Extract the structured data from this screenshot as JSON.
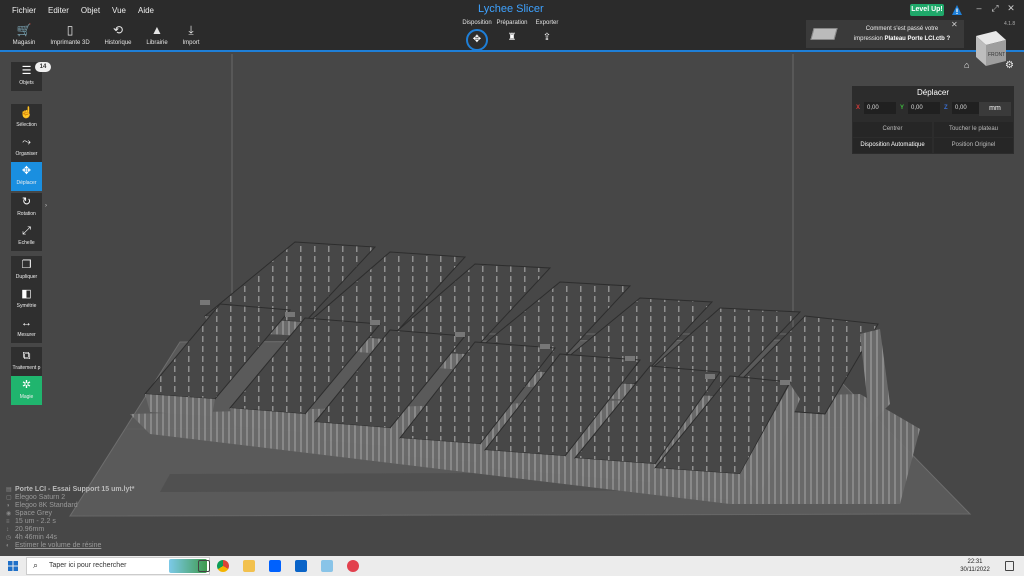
{
  "menu": [
    "Fichier",
    "Editer",
    "Objet",
    "Vue",
    "Aide"
  ],
  "app_title": "Lychee Slicer",
  "level_up": "Level Up!",
  "toolbar": [
    {
      "icon": "cart-icon",
      "glyph": "🛒",
      "label": "Magasin"
    },
    {
      "icon": "phone-icon",
      "glyph": "▯",
      "label": "Imprimante 3D"
    },
    {
      "icon": "history-icon",
      "glyph": "⟲",
      "label": "Historique"
    },
    {
      "icon": "library-icon",
      "glyph": "▲",
      "label": "Librairie"
    },
    {
      "icon": "import-icon",
      "glyph": "⤓",
      "label": "Import"
    }
  ],
  "tabs": [
    {
      "label": "Disposition",
      "glyph": "✥",
      "active": true
    },
    {
      "label": "Préparation",
      "glyph": "♜",
      "active": false
    },
    {
      "label": "Exporter",
      "glyph": "⇪",
      "active": false
    }
  ],
  "notification": {
    "line1": "Comment s'est passé votre",
    "line2_prefix": "impression",
    "line2_file": "Plateau Porte LCI.ctb ?"
  },
  "version": "4.1.8",
  "cube_label": "FRONT",
  "objects_badge": "14",
  "tools": [
    {
      "name": "objects",
      "glyph": "☰",
      "label": "Objets",
      "state": "normal",
      "arrow": false
    },
    {
      "name": "selection",
      "glyph": "☝",
      "label": "Sélection",
      "state": "normal",
      "arrow": false
    },
    {
      "name": "organize",
      "glyph": "⤳",
      "label": "Organiser",
      "state": "normal",
      "arrow": false
    },
    {
      "name": "move",
      "glyph": "✥",
      "label": "Déplacer",
      "state": "active",
      "arrow": false
    },
    {
      "name": "rotation",
      "glyph": "↻",
      "label": "Rotation",
      "state": "normal",
      "arrow": true
    },
    {
      "name": "scale",
      "glyph": "⤢",
      "label": "Echelle",
      "state": "normal",
      "arrow": false
    },
    {
      "name": "duplicate",
      "glyph": "❐",
      "label": "Dupliquer",
      "state": "normal",
      "arrow": false
    },
    {
      "name": "symmetry",
      "glyph": "◧",
      "label": "Symétrie",
      "state": "normal",
      "arrow": false
    },
    {
      "name": "measure",
      "glyph": "↔",
      "label": "Mesurer",
      "state": "normal",
      "arrow": false
    },
    {
      "name": "processing",
      "glyph": "⧉",
      "label": "Traitement p",
      "state": "normal",
      "arrow": false
    },
    {
      "name": "magic",
      "glyph": "✲",
      "label": "Magie",
      "state": "green",
      "arrow": false
    }
  ],
  "move_panel": {
    "title": "Déplacer",
    "x_label": "X",
    "x": "0,00",
    "y_label": "Y",
    "y": "0,00",
    "z_label": "Z",
    "z": "0,00",
    "unit": "mm",
    "center": "Centrer",
    "touch_plate": "Toucher le plateau",
    "auto_layout": "Disposition Automatique",
    "original_position": "Position Originel"
  },
  "info": {
    "file": "Porte LCI - Essai Support 15 um.lyt*",
    "printer": "Elegoo Saturn 2",
    "screen": "Elegoo 8K Standard",
    "resin": "Space Grey",
    "layer": "15 um - 2.2 s",
    "height": "20.96mm",
    "time": "4h 46min 44s",
    "estimate": "Estimer le volume de résine"
  },
  "taskbar": {
    "search_placeholder": "Taper ici pour rechercher",
    "time": "22:31",
    "date": "30/11/2022"
  },
  "colors": {
    "accent": "#1e7fd8",
    "level_up": "#1fa86a",
    "magic": "#20b56e",
    "x_axis": "#d43a3a",
    "y_axis": "#3fbf3f",
    "z_axis": "#3a6fd4"
  }
}
